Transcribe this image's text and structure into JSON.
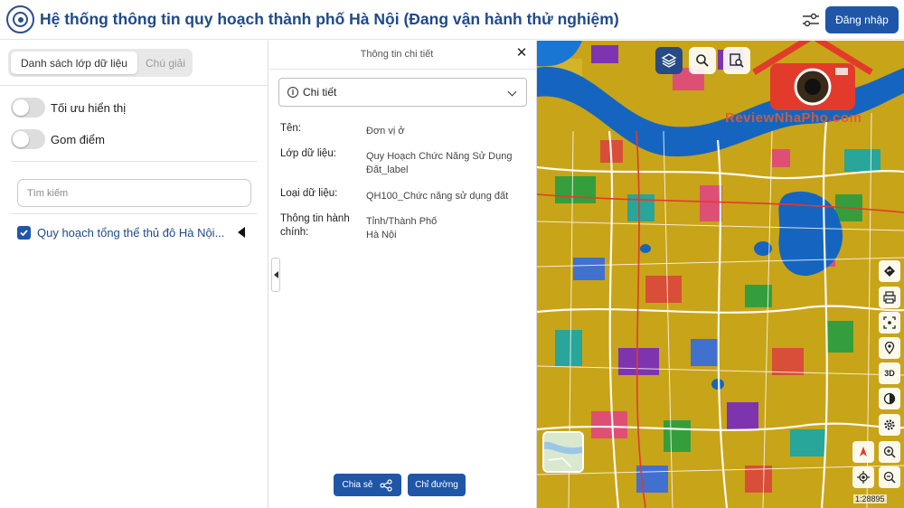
{
  "header": {
    "title": "Hệ thống thông tin quy hoạch thành phố Hà Nội (Đang vận hành thử nghiệm)",
    "login_label": "Đăng nhập"
  },
  "left_panel": {
    "tabs": [
      {
        "label": "Danh sách lớp dữ liệu",
        "active": true
      },
      {
        "label": "Chú giải",
        "active": false
      }
    ],
    "toggles": [
      {
        "label": "Tối ưu hiển thị",
        "on": false
      },
      {
        "label": "Gom điểm",
        "on": false
      }
    ],
    "search": {
      "placeholder": "Tìm kiếm",
      "value": ""
    },
    "layers": [
      {
        "label": "Quy hoạch tổng thể thủ đô Hà Nội...",
        "checked": true
      }
    ]
  },
  "detail_panel": {
    "title": "Thông tin chi tiết",
    "select_label": "Chi tiết",
    "fields": [
      {
        "key": "Tên:",
        "value": "Đơn vị ở"
      },
      {
        "key": "Lớp dữ liệu:",
        "value": "Quy Hoạch Chức Năng Sử Dụng Đất_label"
      },
      {
        "key": "Loại dữ liệu:",
        "value": "QH100_Chức năng sử dụng đất"
      },
      {
        "key": "Thông tin hành chính:",
        "value": "Tỉnh/Thành Phố\nHà Nội"
      }
    ],
    "share_label": "Chia sẻ",
    "directions_label": "Chỉ đường"
  },
  "map": {
    "scale_text": "1:28895",
    "watermark_text": "ReviewNhaPho.com",
    "colors": {
      "residential": "#c8a418",
      "water": "#1565c0",
      "park": "#2e9e3e",
      "accent": "#1f56a8"
    },
    "side_buttons": [
      "route-icon",
      "print-icon",
      "fullscreen-icon",
      "location-pin-icon",
      "3D",
      "contrast-icon",
      "settings-icon",
      "compass-icon",
      "zoom-in-icon",
      "zoom-out-icon",
      "my-location-icon"
    ]
  }
}
